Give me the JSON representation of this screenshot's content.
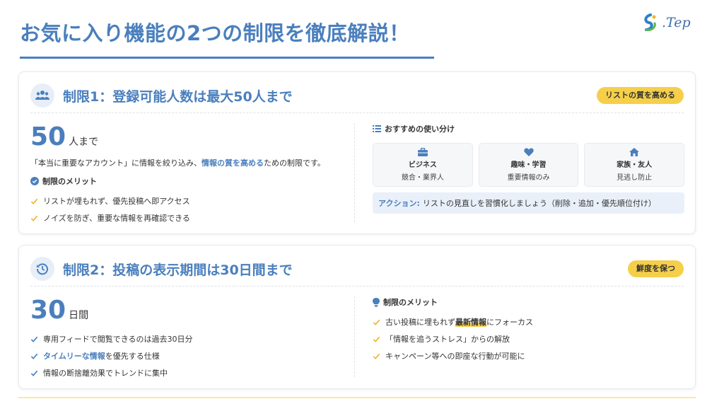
{
  "page": {
    "title": "お気に入り機能の2つの制限を徹底解説！"
  },
  "logo": {
    "text": ".Tep"
  },
  "card1": {
    "title": "制限1：登録可能人数は最大50人まで",
    "badge": "リストの質を高める",
    "number": "50",
    "unit": "人まで",
    "desc_pre": "「本当に重要なアカウント」に情報を絞り込み、",
    "desc_hl": "情報の質を高める",
    "desc_post": "ための制限です。",
    "merit_heading": "制限のメリット",
    "merits": [
      "リストが埋もれず、優先投稿へ即アクセス",
      "ノイズを防ぎ、重要な情報を再確認できる"
    ],
    "uses_heading": "おすすめの使い分け",
    "uses": [
      {
        "icon": "briefcase-icon",
        "label": "ビジネス",
        "sub": "競合・業界人"
      },
      {
        "icon": "heart-icon",
        "label": "趣味・学習",
        "sub": "重要情報のみ"
      },
      {
        "icon": "home-icon",
        "label": "家族・友人",
        "sub": "見逃し防止"
      }
    ],
    "action_label": "アクション:",
    "action_text": "リストの見直しを習慣化しましょう（削除・追加・優先順位付け）"
  },
  "card2": {
    "title": "制限2：投稿の表示期間は30日間まで",
    "badge": "鮮度を保つ",
    "number": "30",
    "unit": "日間",
    "points": [
      {
        "pre": "専用フィードで閲覧できるのは過去30日分",
        "hl": "",
        "post": ""
      },
      {
        "pre": "",
        "hl": "タイムリーな情報",
        "post": "を優先する仕様"
      },
      {
        "pre": "情報の断捨離効果でトレンドに集中",
        "hl": "",
        "post": ""
      }
    ],
    "merit_heading": "制限のメリット",
    "merits": [
      {
        "pre": "古い投稿に埋もれず",
        "hl": "最新情報",
        "post": "にフォーカス"
      },
      {
        "pre": "「情報を追うストレス」からの解放",
        "hl": "",
        "post": ""
      },
      {
        "pre": "キャンペーン等への即座な行動が可能に",
        "hl": "",
        "post": ""
      }
    ]
  },
  "colors": {
    "accent": "#4a7fbd",
    "badge": "#f6cf4a",
    "check_yellow": "#f0b528"
  }
}
